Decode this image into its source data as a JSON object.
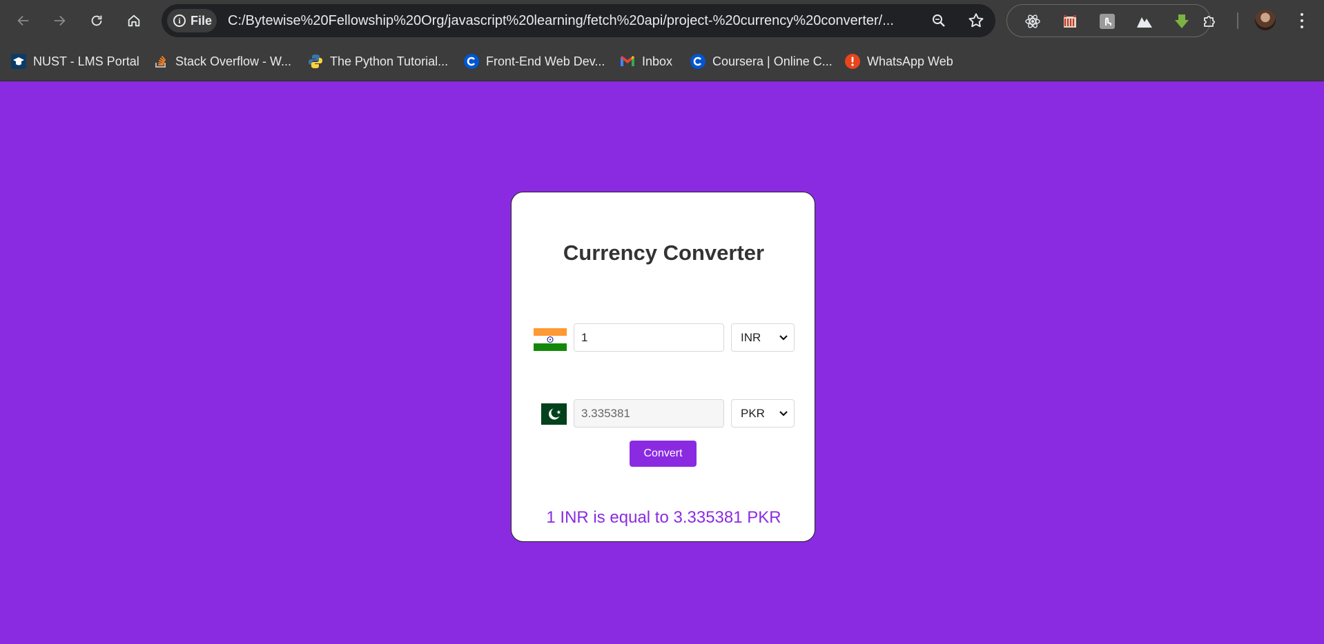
{
  "browser": {
    "url_chip": "File",
    "url": "C:/Bytewise%20Fellowship%20Org/javascript%20learning/fetch%20api/project-%20currency%20converter/...",
    "bookmarks": [
      {
        "label": "NUST - LMS Portal",
        "icon": "graduation-cap-icon"
      },
      {
        "label": "Stack Overflow - W...",
        "icon": "stack-overflow-icon"
      },
      {
        "label": "The Python Tutorial...",
        "icon": "python-icon"
      },
      {
        "label": "Front-End Web Dev...",
        "icon": "coursera-icon"
      },
      {
        "label": "Inbox",
        "icon": "gmail-icon"
      },
      {
        "label": "Coursera | Online C...",
        "icon": "coursera-icon"
      },
      {
        "label": "WhatsApp Web",
        "icon": "alert-icon"
      }
    ],
    "colors": {
      "chrome": "#3c3c3c",
      "omnibox": "#202124",
      "text": "#e8eaed"
    }
  },
  "app": {
    "title": "Currency Converter",
    "from": {
      "amount": "1",
      "currency": "INR",
      "flag": "india-flag"
    },
    "to": {
      "amount": "3.335381",
      "currency": "PKR",
      "flag": "pakistan-flag"
    },
    "convert_label": "Convert",
    "result": "1 INR is equal to 3.335381 PKR",
    "colors": {
      "accent": "#8a2be2",
      "card": "#ffffff",
      "title": "#333333"
    }
  }
}
